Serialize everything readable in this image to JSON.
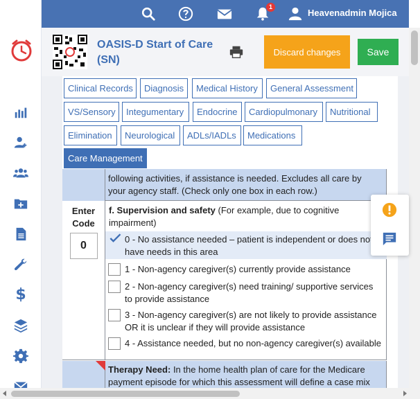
{
  "topbar": {
    "notification_count": "1",
    "user_name": "Heavenadmin Mojica",
    "icons": [
      "search-icon",
      "help-icon",
      "mail-icon",
      "bell-icon",
      "user-icon"
    ]
  },
  "sidebar": {
    "items": [
      "chart-icon",
      "user-add-icon",
      "users-icon",
      "folder-add-icon",
      "document-icon",
      "wrench-icon",
      "dollar-icon",
      "layers-icon",
      "gear-icon",
      "mail-icon"
    ]
  },
  "header": {
    "title": "OASIS-D Start of Care (SN)",
    "discard_label": "Discard changes",
    "save_label": "Save"
  },
  "tabs": [
    "Clinical Records",
    "Diagnosis",
    "Medical History",
    "General Assessment",
    "VS/Sensory",
    "Integumentary",
    "Endocrine",
    "Cardiopulmonary",
    "Nutritional",
    "Elimination",
    "Neurological",
    "ADLs/IADLs",
    "Medications",
    "Care Management"
  ],
  "active_tab": "Care Management",
  "section": {
    "truncated_text": "following activities, if assistance is needed. Excludes all care by your agency staff. (Check only one box in each row.)",
    "enter_code_label": "Enter Code",
    "code_value": "0",
    "question_title": "f. Supervision and safety",
    "question_detail": "(For example, due to cognitive impairment)",
    "options": [
      {
        "label": "0 - No assistance needed – patient is independent or does not have needs in this area",
        "selected": true
      },
      {
        "label": "1 - Non-agency caregiver(s) currently provide assistance",
        "selected": false
      },
      {
        "label": "2 - Non-agency caregiver(s) need training/ supportive services to provide assistance",
        "selected": false
      },
      {
        "label": "3 - Non-agency caregiver(s) are not likely to provide assistance OR it is unclear if they will provide assistance",
        "selected": false
      },
      {
        "label": "4 - Assistance needed, but no non-agency caregiver(s) available",
        "selected": false
      }
    ],
    "therapy_title": "Therapy Need:",
    "therapy_text": "In the home health plan of care for the Medicare payment episode for which this assessment will define a case mix"
  },
  "floating": {
    "icons": [
      "alert-icon",
      "chat-icon"
    ],
    "colors": {
      "alert": "#f5a31a",
      "chat": "#3f6fb5"
    }
  },
  "colors": {
    "primary": "#4872b3",
    "discard": "#f5a31a",
    "save": "#2fae52",
    "highlight": "#c7d7ef"
  }
}
